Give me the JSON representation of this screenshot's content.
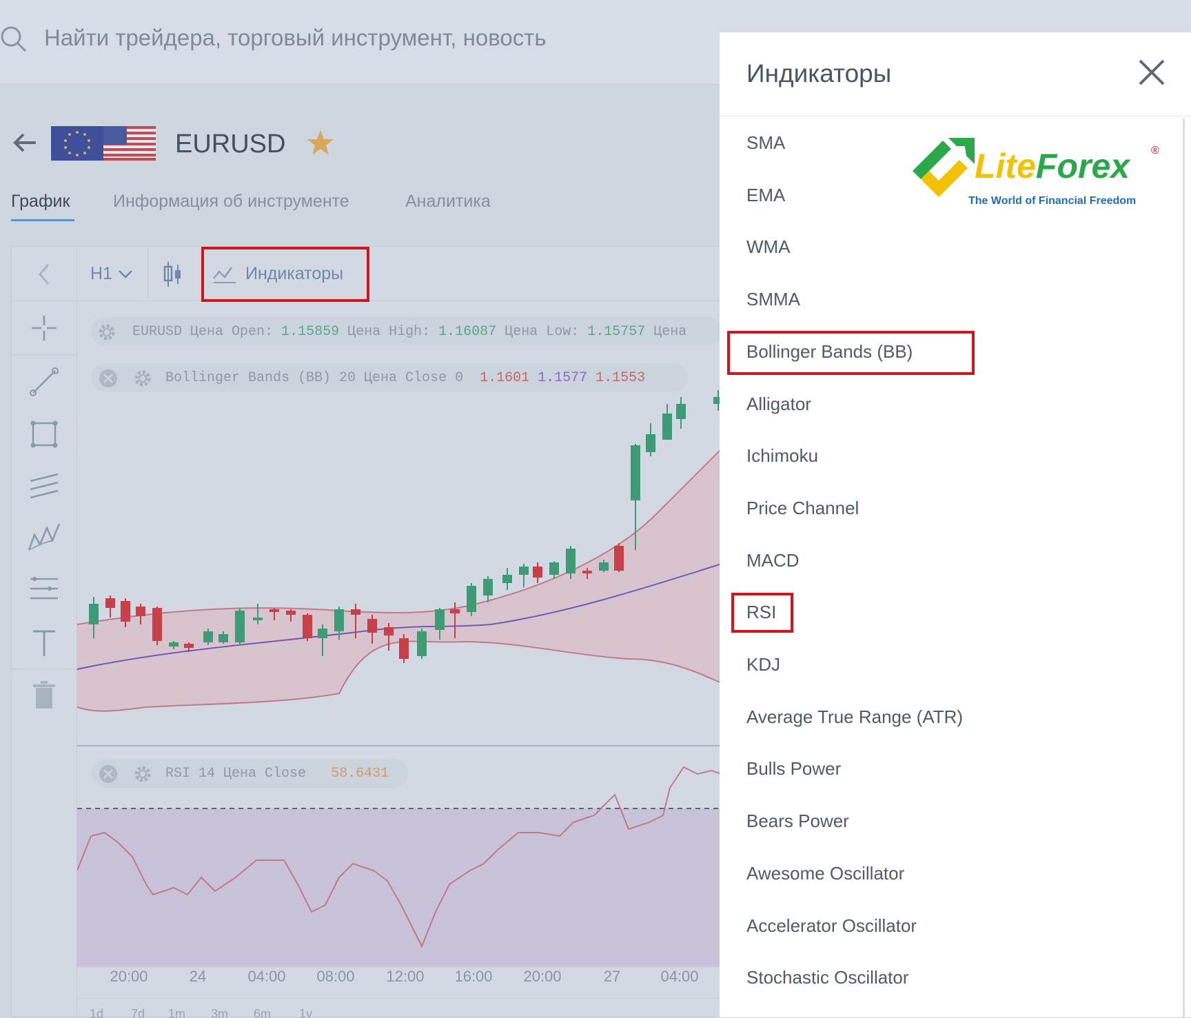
{
  "search": {
    "placeholder": "Найти трейдера, торговый инструмент, новость"
  },
  "instrument": {
    "symbol": "EURUSD"
  },
  "tabs": [
    {
      "label": "График",
      "active": true
    },
    {
      "label": "Информация об инструменте",
      "active": false
    },
    {
      "label": "Аналитика",
      "active": false
    }
  ],
  "toolbar": {
    "timeframe": "H1",
    "indicators_label": "Индикаторы"
  },
  "info_line": {
    "symbol": "EURUSD",
    "open_label": "Цена Open:",
    "open": "1.15859",
    "high_label": "Цена High:",
    "high": "1.16087",
    "low_label": "Цена Low:",
    "low": "1.15757",
    "tail": "Цена"
  },
  "bb_line": {
    "label": "Bollinger Bands (BB) 20 Цена Close 0",
    "upper": "1.1601",
    "middle": "1.1577",
    "lower": "1.1553"
  },
  "rsi_line": {
    "label": "RSI 14 Цена Close",
    "value": "58.6431"
  },
  "x_axis": [
    "20:00",
    "24",
    "04:00",
    "08:00",
    "12:00",
    "16:00",
    "20:00",
    "27",
    "04:00"
  ],
  "periods": [
    "1d",
    "7d",
    "1m",
    "3m",
    "6m",
    "1y"
  ],
  "indicator_panel": {
    "title": "Индикаторы",
    "items": [
      {
        "label": "SMA",
        "highlighted": false
      },
      {
        "label": "EMA",
        "highlighted": false
      },
      {
        "label": "WMA",
        "highlighted": false
      },
      {
        "label": "SMMA",
        "highlighted": false
      },
      {
        "label": "Bollinger Bands (BB)",
        "highlighted": true
      },
      {
        "label": "Alligator",
        "highlighted": false
      },
      {
        "label": "Ichimoku",
        "highlighted": false
      },
      {
        "label": "Price Channel",
        "highlighted": false
      },
      {
        "label": "MACD",
        "highlighted": false
      },
      {
        "label": "RSI",
        "highlighted": true
      },
      {
        "label": "KDJ",
        "highlighted": false
      },
      {
        "label": "Average True Range (ATR)",
        "highlighted": false
      },
      {
        "label": "Bulls Power",
        "highlighted": false
      },
      {
        "label": "Bears Power",
        "highlighted": false
      },
      {
        "label": "Awesome Oscillator",
        "highlighted": false
      },
      {
        "label": "Accelerator Oscillator",
        "highlighted": false
      },
      {
        "label": "Stochastic Oscillator",
        "highlighted": false
      }
    ]
  },
  "watermark": {
    "brand_a": "Lite",
    "brand_b": "Forex",
    "registered": "®",
    "tagline": "The World of Financial Freedom"
  },
  "colors": {
    "up": "#3f9a76",
    "down": "#c8404a",
    "highlight": "#d0161c",
    "brand_green": "#2aa84a",
    "brand_yellow": "#f2c200",
    "brand_blue": "#1e6fb8"
  }
}
